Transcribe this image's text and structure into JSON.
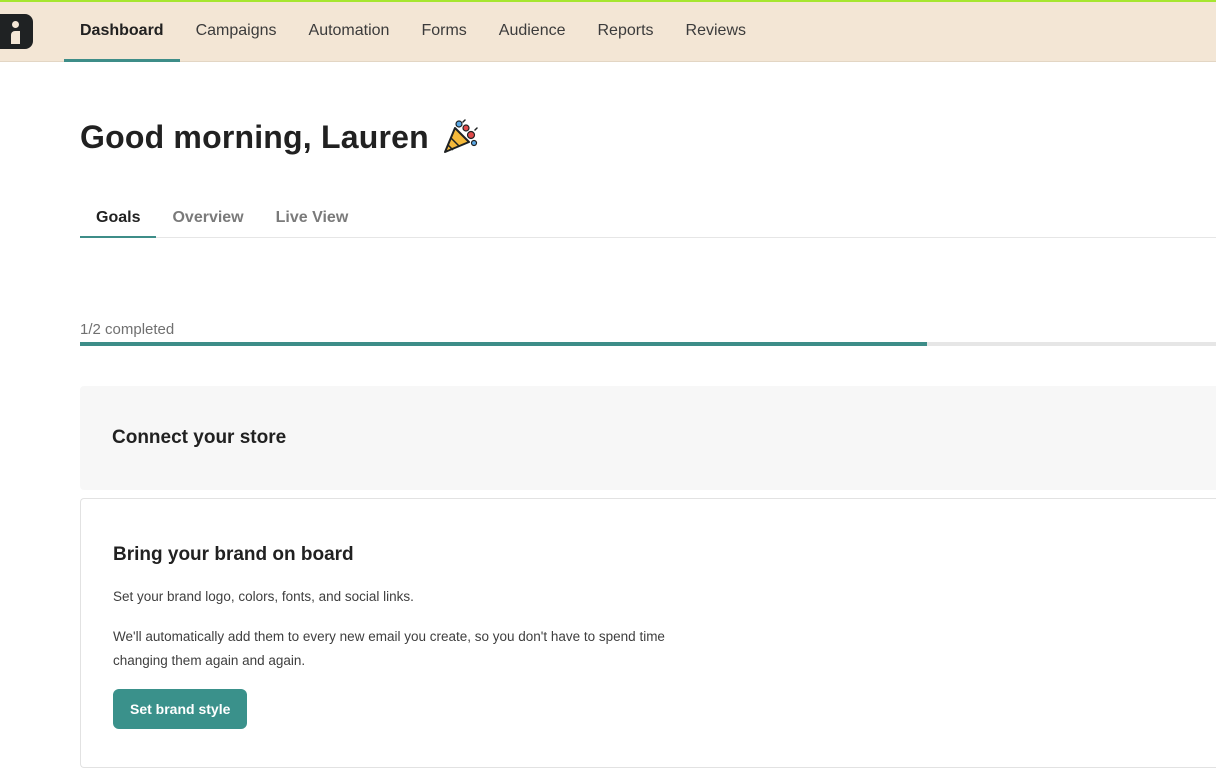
{
  "nav": {
    "items": [
      {
        "label": "Dashboard",
        "active": true
      },
      {
        "label": "Campaigns"
      },
      {
        "label": "Automation"
      },
      {
        "label": "Forms"
      },
      {
        "label": "Audience"
      },
      {
        "label": "Reports"
      },
      {
        "label": "Reviews"
      }
    ]
  },
  "page": {
    "greeting": "Good morning, Lauren",
    "greeting_icon": "party-popper-icon"
  },
  "tabs": [
    {
      "label": "Goals",
      "active": true
    },
    {
      "label": "Overview"
    },
    {
      "label": "Live View"
    }
  ],
  "progress": {
    "label": "1/2 completed",
    "completed": 1,
    "total": 2,
    "fill_percent": 74.6
  },
  "goals": [
    {
      "title": "Connect your store",
      "expanded": false
    },
    {
      "title": "Bring your brand on board",
      "expanded": true,
      "description_1": "Set your brand logo, colors, fonts, and social links.",
      "description_2": "We'll automatically add them to every new email you create, so you don't have to spend time changing them again and again.",
      "button_label": "Set brand style"
    }
  ],
  "colors": {
    "accent": "#3d8d88",
    "topbar_bg": "#f3e6d5",
    "top_stripe": "#a6e630",
    "button_bg": "#3a918b"
  }
}
